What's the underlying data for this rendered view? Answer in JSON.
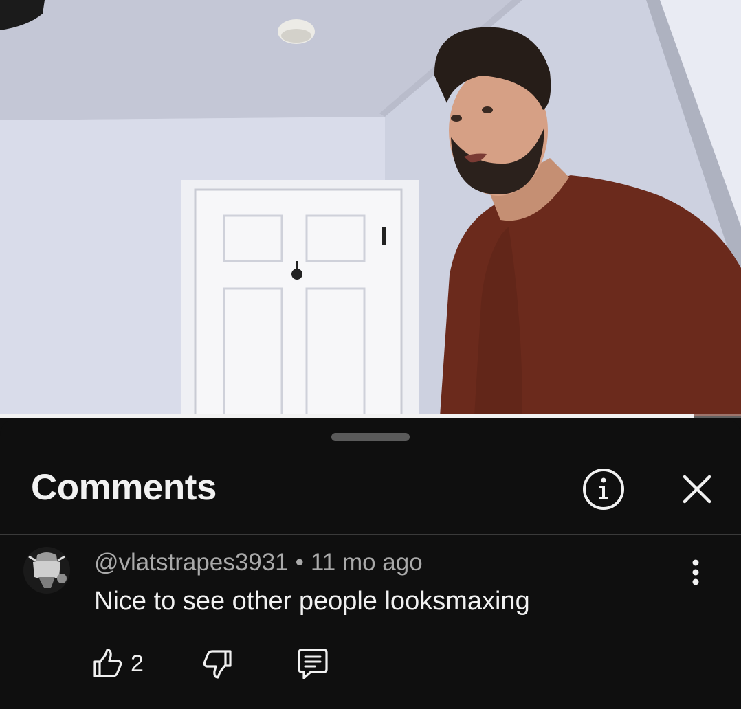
{
  "player": {
    "progress_fraction": 0.937
  },
  "comments_panel": {
    "title": "Comments",
    "info_icon": "info-icon",
    "close_icon": "close-icon"
  },
  "comment": {
    "author": "@vlatstrapes3931",
    "separator": "•",
    "time_ago": "11 mo ago",
    "text": "Nice to see other people looksmaxing",
    "like_count": "2",
    "icons": [
      "thumbs-up-icon",
      "thumbs-down-icon",
      "reply-icon",
      "more-vertical-icon"
    ]
  },
  "colors": {
    "background": "#0f0f0f",
    "text_primary": "#f1f1f1",
    "text_secondary": "#aaaaaa",
    "divider": "#3a3a3a"
  }
}
